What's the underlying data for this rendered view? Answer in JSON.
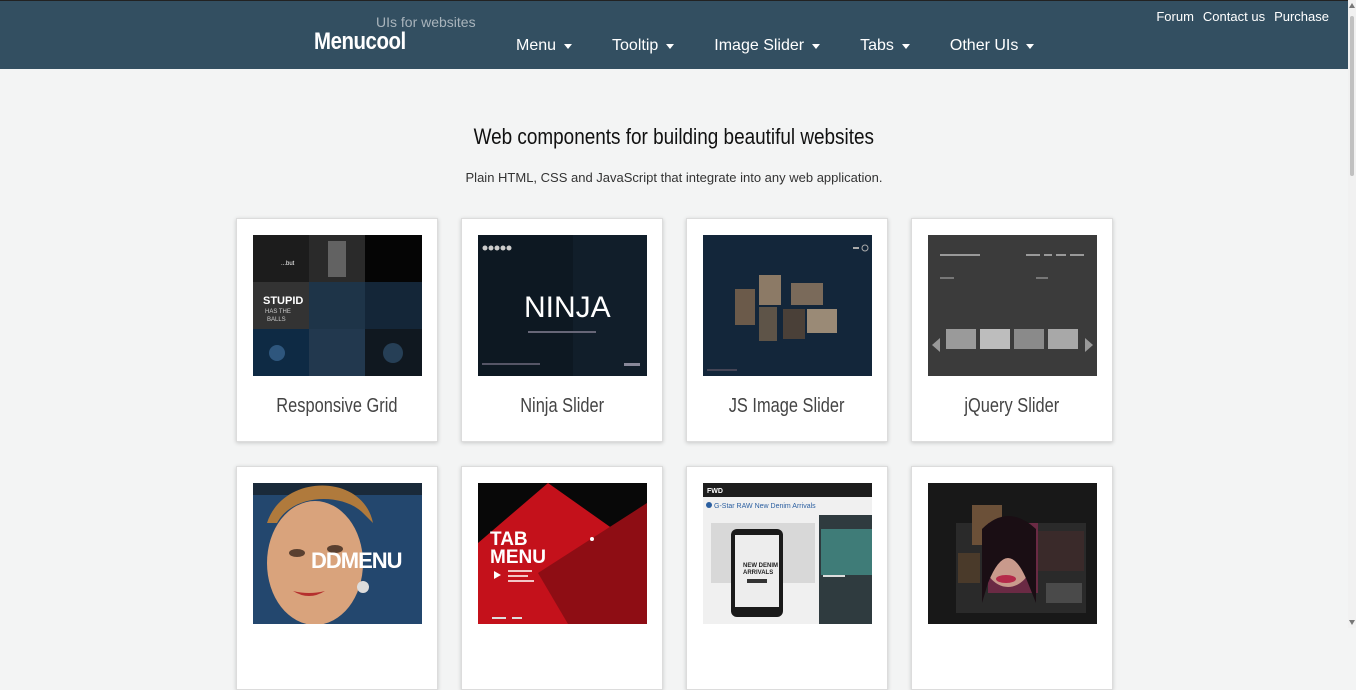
{
  "header": {
    "brand": "Menucool",
    "tagline": "UIs for websites",
    "nav": [
      "Menu",
      "Tooltip",
      "Image Slider",
      "Tabs",
      "Other UIs"
    ],
    "top_links": [
      "Forum",
      "Contact us",
      "Purchase"
    ]
  },
  "hero": {
    "title": "Web components for building beautiful websites",
    "subtitle": "Plain HTML, CSS and JavaScript that integrate into any web application."
  },
  "cards": [
    {
      "title": "Responsive Grid",
      "thumb_text": [
        "...but",
        "STUPID",
        "HAS THE",
        "BALLS"
      ]
    },
    {
      "title": "Ninja Slider",
      "thumb_text": [
        "NINJA"
      ]
    },
    {
      "title": "JS Image Slider",
      "thumb_text": []
    },
    {
      "title": "jQuery Slider",
      "thumb_text": []
    },
    {
      "title": "",
      "thumb_text": [
        "DDMENU"
      ]
    },
    {
      "title": "",
      "thumb_text": [
        "TAB",
        "MENU"
      ]
    },
    {
      "title": "",
      "thumb_text": [
        "G-Star RAW New Denim Arrivals",
        "NEW DENIM",
        "ARRIVALS"
      ]
    },
    {
      "title": "",
      "thumb_text": []
    }
  ],
  "colors": {
    "header_bg": "#334f61",
    "page_bg": "#f3f4f4",
    "accent_red": "#c4111b"
  }
}
